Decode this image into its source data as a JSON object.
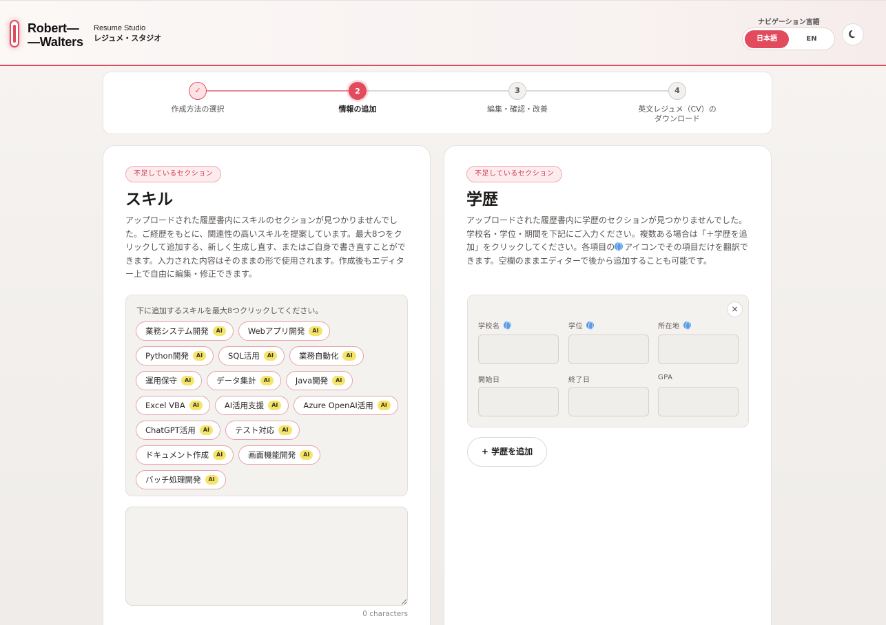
{
  "header": {
    "logo_line1": "Robert—",
    "logo_line2": "—Walters",
    "brand_en": "Resume Studio",
    "brand_ja": "レジュメ・スタジオ",
    "nav_language_label": "ナビゲーション言語",
    "lang_ja": "日本語",
    "lang_en": "EN",
    "theme_icon": "moon-icon"
  },
  "stepper": {
    "steps": [
      {
        "number": "✓",
        "label": "作成方法の選択",
        "state": "done"
      },
      {
        "number": "2",
        "label": "情報の追加",
        "state": "active"
      },
      {
        "number": "3",
        "label": "編集・確認・改善",
        "state": "todo"
      },
      {
        "number": "4",
        "label": "英文レジュメ（CV）の\nダウンロード",
        "state": "todo"
      }
    ]
  },
  "skills": {
    "badge": "不足しているセクション",
    "title": "スキル",
    "description": "アップロードされた履歴書内にスキルのセクションが見つかりませんでした。ご経歴をもとに、関連性の高いスキルを提案しています。最大8つをクリックして追加する、新しく生成し直す、またはご自身で書き直すことができます。入力された内容はそのままの形で使用されます。作成後もエディター上で自由に編集・修正できます。",
    "prompt": "下に追加するスキルを最大8つクリックしてください。",
    "ai_tag": "AI",
    "suggestions": [
      "業務システム開発",
      "Webアプリ開発",
      "Python開発",
      "SQL活用",
      "業務自動化",
      "運用保守",
      "データ集計",
      "Java開発",
      "Excel VBA",
      "AI活用支援",
      "Azure OpenAI活用",
      "ChatGPT活用",
      "テスト対応",
      "ドキュメント作成",
      "画面機能開発",
      "バッチ処理開発"
    ],
    "textarea_value": "",
    "char_count": "0 characters"
  },
  "education": {
    "badge": "不足しているセクション",
    "title": "学歴",
    "description_part1": "アップロードされた履歴書内に学歴のセクションが見つかりませんでした。学校名・学位・期間を下記にご入力ください。複数ある場合は「＋学歴を追加」をクリックしてください。各項目の",
    "description_part2": "アイコンでその項目だけを翻訳できます。空欄のままエディターで後から追加することも可能です。",
    "close": "×",
    "fields": {
      "school": "学校名",
      "degree": "学位",
      "location": "所在地",
      "start": "開始日",
      "end": "終了日",
      "gpa": "GPA"
    },
    "add_button": "+ 学歴を追加"
  }
}
